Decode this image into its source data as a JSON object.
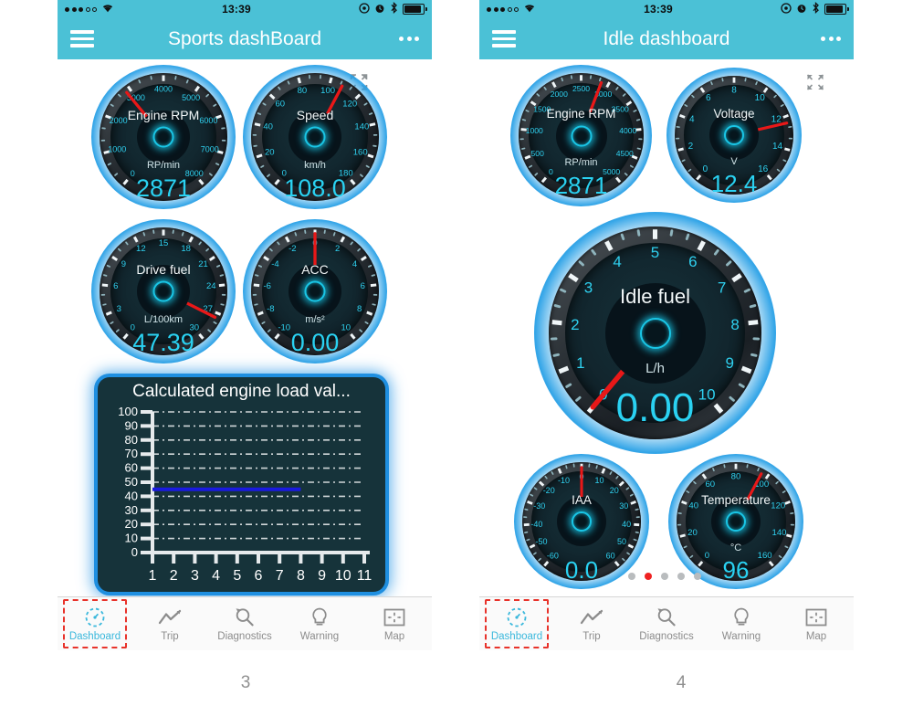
{
  "captions": {
    "left": "3",
    "right": "4"
  },
  "statusbar": {
    "signal_dots": [
      true,
      true,
      true,
      false,
      false
    ],
    "time": "13:39",
    "icons": [
      "location-icon",
      "alarm-icon",
      "bluetooth-icon",
      "battery-icon"
    ],
    "wifi": "wifi-icon"
  },
  "left": {
    "navbar": {
      "title": "Sports dashBoard",
      "menu_icon": "hamburger-icon",
      "more_icon": "more-options-icon"
    },
    "expand_icon": "expand-fullscreen-icon",
    "gauges": [
      {
        "id": "engine-rpm",
        "title": "Engine RPM",
        "unit": "RP/min",
        "value": "2871",
        "min": 0,
        "max": 8000,
        "step": 1000,
        "needle": 2871,
        "ticks": [
          "0",
          "1000",
          "2000",
          "3000",
          "4000",
          "5000",
          "6000",
          "7000",
          "8000"
        ]
      },
      {
        "id": "speed",
        "title": "Speed",
        "unit": "km/h",
        "value": "108.0",
        "min": 0,
        "max": 180,
        "step": 20,
        "needle": 108,
        "ticks": [
          "0",
          "20",
          "40",
          "60",
          "80",
          "100",
          "120",
          "140",
          "160",
          "180"
        ]
      },
      {
        "id": "drive-fuel",
        "title": "Drive fuel",
        "unit": "L/100km",
        "value": "47.39",
        "min": 0,
        "max": 30,
        "step": 3,
        "needle": 27.5,
        "ticks": [
          "0",
          "3",
          "6",
          "9",
          "12",
          "15",
          "18",
          "21",
          "24",
          "27",
          "30"
        ]
      },
      {
        "id": "acc",
        "title": "ACC",
        "unit": "m/s²",
        "value": "0.00",
        "min": -10,
        "max": 10,
        "step": 2,
        "needle": 0,
        "ticks": [
          "-10",
          "-8",
          "-6",
          "-4",
          "-2",
          "0",
          "2",
          "4",
          "6",
          "8",
          "10"
        ]
      }
    ],
    "chart": {
      "title": "Calculated engine load val..."
    },
    "chart_data": {
      "type": "line",
      "title": "Calculated engine load val...",
      "xlabel": "",
      "ylabel": "",
      "x": [
        1,
        2,
        3,
        4,
        5,
        6,
        7,
        8,
        9,
        10,
        11
      ],
      "xticks": [
        "1",
        "2",
        "3",
        "4",
        "5",
        "6",
        "7",
        "8",
        "9",
        "10",
        "11"
      ],
      "yticks": [
        "0",
        "10",
        "20",
        "30",
        "40",
        "50",
        "60",
        "70",
        "80",
        "90",
        "100"
      ],
      "ylim": [
        0,
        100
      ],
      "xlim": [
        1,
        11
      ],
      "grid": true,
      "legend": "none",
      "series": [
        {
          "name": "Calculated engine load value",
          "color": "#1a1ae0",
          "x": [
            1,
            2,
            3,
            4,
            5,
            6,
            7,
            8
          ],
          "values": [
            45,
            45,
            45,
            45,
            45,
            45,
            45,
            45
          ]
        }
      ]
    }
  },
  "right": {
    "navbar": {
      "title": "Idle dashboard",
      "menu_icon": "hamburger-icon",
      "more_icon": "more-options-icon"
    },
    "expand_icon": "expand-fullscreen-icon",
    "gauges": [
      {
        "id": "engine-rpm",
        "title": "Engine RPM",
        "unit": "RP/min",
        "value": "2871",
        "min": 0,
        "max": 5000,
        "step": 500,
        "needle": 2871,
        "ticks": [
          "0",
          "500",
          "1000",
          "1500",
          "2000",
          "2500",
          "3000",
          "3500",
          "4000",
          "4500",
          "5000"
        ]
      },
      {
        "id": "voltage",
        "title": "Voltage",
        "unit": "V",
        "value": "12.4",
        "min": 0,
        "max": 16,
        "step": 2,
        "needle": 12.4,
        "ticks": [
          "0",
          "2",
          "4",
          "6",
          "8",
          "10",
          "12",
          "14",
          "16"
        ]
      },
      {
        "id": "idle-fuel",
        "title": "Idle fuel",
        "unit": "L/h",
        "value": "0.00",
        "min": 0,
        "max": 10,
        "step": 1,
        "needle": 0,
        "ticks": [
          "0",
          "1",
          "2",
          "3",
          "4",
          "5",
          "6",
          "7",
          "8",
          "9",
          "10"
        ]
      },
      {
        "id": "iaa",
        "title": "IAA",
        "unit": "",
        "value": "0.0",
        "min": -60,
        "max": 60,
        "step": 10,
        "needle": 0,
        "ticks": [
          "-60",
          "-50",
          "-40",
          "-30",
          "-20",
          "-10",
          "0",
          "10",
          "20",
          "30",
          "40",
          "50",
          "60"
        ]
      },
      {
        "id": "temperature",
        "title": "Temperature",
        "unit": "°C",
        "value": "96",
        "min": 0,
        "max": 160,
        "step": 20,
        "needle": 96,
        "ticks": [
          "0",
          "20",
          "40",
          "60",
          "80",
          "100",
          "120",
          "140",
          "160"
        ]
      }
    ],
    "pagedots": {
      "count": 5,
      "active_index": 1,
      "active_color": "#ef2222"
    }
  },
  "tabbar": {
    "items": [
      {
        "label": "Dashboard",
        "icon": "dashboard-gauge-icon",
        "active": true
      },
      {
        "label": "Trip",
        "icon": "trip-line-chart-icon",
        "active": false
      },
      {
        "label": "Diagnostics",
        "icon": "diagnostics-search-icon",
        "active": false
      },
      {
        "label": "Warning",
        "icon": "warning-bulb-icon",
        "active": false
      },
      {
        "label": "Map",
        "icon": "map-crosshair-icon",
        "active": false
      }
    ],
    "active_color": "#3ab8dc",
    "highlight_color": "#e8322a"
  }
}
